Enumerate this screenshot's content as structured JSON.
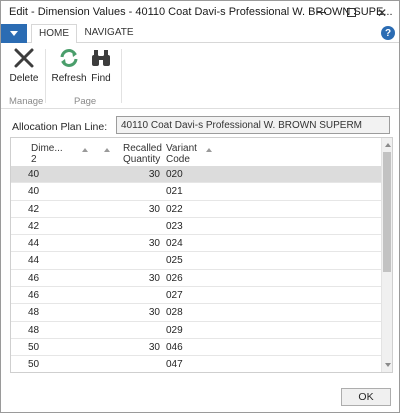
{
  "window": {
    "title": "Edit - Dimension Values - 40110 Coat Davi-s Professional W. BROWN SUPE...",
    "minimize_glyph": "",
    "close_glyph": "✕"
  },
  "tabs": {
    "home": "HOME",
    "navigate": "NAVIGATE",
    "help": "?"
  },
  "ribbon": {
    "delete_label": "Delete",
    "refresh_label": "Refresh",
    "find_label": "Find",
    "group_manage": "Manage",
    "group_page": "Page"
  },
  "field": {
    "label": "Allocation Plan Line:",
    "value": "40110 Coat Davi-s Professional W. BROWN SUPERM"
  },
  "grid": {
    "columns": [
      "Dime... 2",
      "Recalled Quantity",
      "Variant Code"
    ],
    "col1_line1": "Dime...",
    "col1_line2": "2",
    "col2_line1": "Recalled",
    "col2_line2": "Quantity",
    "col3_line1": "Variant",
    "col3_line2": "Code",
    "rows": [
      {
        "dim": "40",
        "qty": "30",
        "var": "020"
      },
      {
        "dim": "40",
        "qty": "",
        "var": "021"
      },
      {
        "dim": "42",
        "qty": "30",
        "var": "022"
      },
      {
        "dim": "42",
        "qty": "",
        "var": "023"
      },
      {
        "dim": "44",
        "qty": "30",
        "var": "024"
      },
      {
        "dim": "44",
        "qty": "",
        "var": "025"
      },
      {
        "dim": "46",
        "qty": "30",
        "var": "026"
      },
      {
        "dim": "46",
        "qty": "",
        "var": "027"
      },
      {
        "dim": "48",
        "qty": "30",
        "var": "028"
      },
      {
        "dim": "48",
        "qty": "",
        "var": "029"
      },
      {
        "dim": "50",
        "qty": "30",
        "var": "046"
      },
      {
        "dim": "50",
        "qty": "",
        "var": "047"
      }
    ]
  },
  "ok_label": "OK",
  "colors": {
    "accent": "#2b6cb3",
    "refresh_icon": "#4a9e6b",
    "selected_row": "#dcdcdc"
  },
  "icons": [
    "delete-icon",
    "refresh-icon",
    "find-icon",
    "app-menu-icon",
    "help-icon"
  ]
}
